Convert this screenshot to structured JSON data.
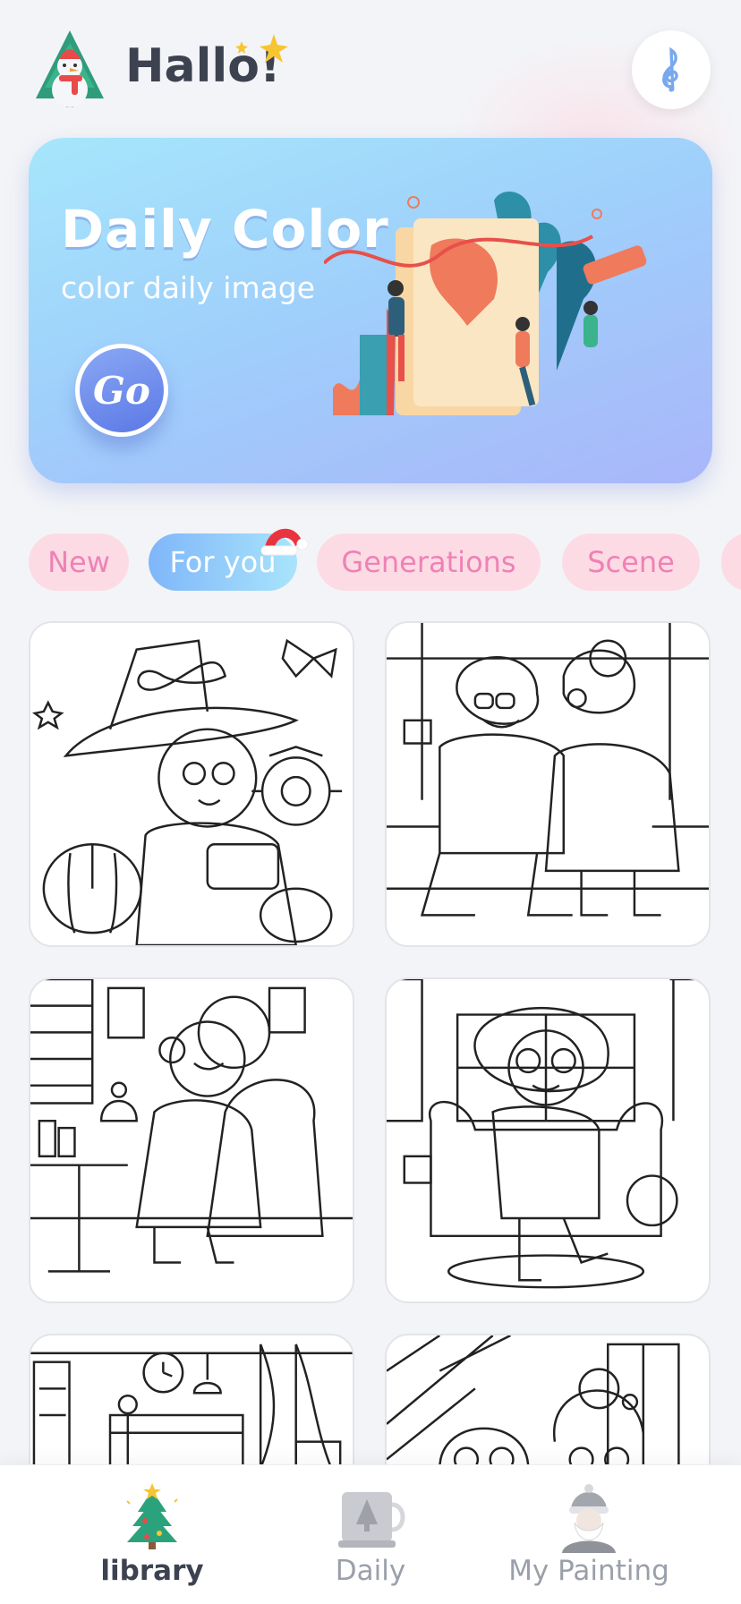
{
  "header": {
    "greeting": "Hallo!",
    "logo_icon": "snowman-tree-logo",
    "music_icon": "treble-clef-icon"
  },
  "banner": {
    "title": "Daily Color",
    "subtitle": "color daily image",
    "go_label": "Go"
  },
  "tabs": [
    {
      "label": "New",
      "active": false
    },
    {
      "label": "For you",
      "active": true
    },
    {
      "label": "Generations",
      "active": false
    },
    {
      "label": "Scene",
      "active": false
    }
  ],
  "gallery": {
    "items": [
      {
        "subject": "grandma-witch-hat-sunflowers"
      },
      {
        "subject": "elderly-couple-kiss-on-bench"
      },
      {
        "subject": "grandma-cupcake-armchair"
      },
      {
        "subject": "grandma-glasses-sofa"
      },
      {
        "subject": "living-room-fireplace-clock"
      },
      {
        "subject": "elderly-couple-portrait"
      }
    ]
  },
  "bottom_nav": {
    "items": [
      {
        "label": "library",
        "icon": "christmas-tree-icon",
        "active": true
      },
      {
        "label": "Daily",
        "icon": "daily-mug-icon",
        "active": false
      },
      {
        "label": "My Painting",
        "icon": "santa-icon",
        "active": false
      }
    ]
  },
  "colors": {
    "accent_pink": "#ee82b4",
    "tab_bg": "#fddbe5",
    "banner_blue": "#9fd0fb",
    "text_dark": "#3d4250"
  }
}
